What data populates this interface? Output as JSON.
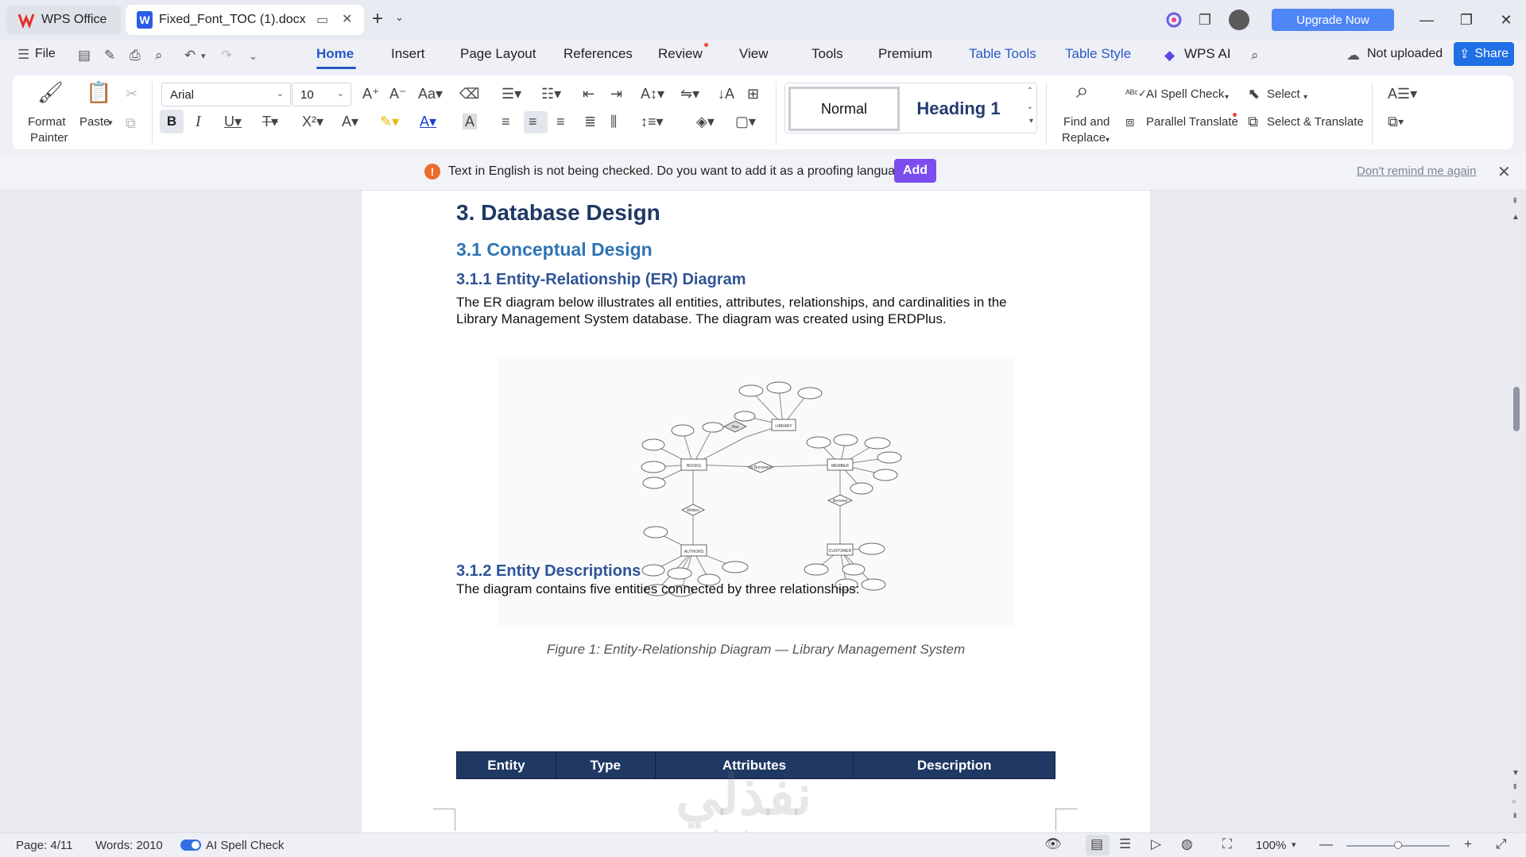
{
  "titlebar": {
    "app_tab": "WPS Office",
    "doc_tab": "Fixed_Font_TOC (1).docx",
    "upgrade": "Upgrade Now"
  },
  "menu": {
    "file": "File",
    "tabs": [
      "Home",
      "Insert",
      "Page Layout",
      "References",
      "Review",
      "View",
      "Tools",
      "Premium",
      "Table Tools",
      "Table Style",
      "WPS AI"
    ],
    "not_uploaded": "Not uploaded",
    "share": "Share"
  },
  "ribbon": {
    "format_painter": [
      "Format",
      "Painter"
    ],
    "paste": "Paste",
    "font": "Arial",
    "size": "10",
    "styles": {
      "normal": "Normal",
      "heading1": "Heading 1"
    },
    "find_replace": [
      "Find and",
      "Replace"
    ],
    "ai_spell": "AI Spell Check",
    "parallel_translate": "Parallel Translate",
    "select": "Select",
    "select_translate": "Select & Translate"
  },
  "notification": {
    "text": "Text in English is not being checked. Do you want to add it as a proofing language?",
    "add": "Add",
    "dont_remind": "Don't remind me again"
  },
  "document": {
    "h_main": "3. Database Design",
    "h_sub": "3.1 Conceptual Design",
    "h_sub2": "3.1.1 Entity-Relationship (ER) Diagram",
    "para1_line1": "The ER diagram below illustrates all entities, attributes, relationships, and cardinalities in the",
    "para1_line2": "Library Management System database. The diagram was created using ERDPlus.",
    "caption": "Figure 1: Entity-Relationship Diagram — Library Management System",
    "h_sub3": "3.1.2 Entity Descriptions",
    "para2": "The diagram contains five entities connected by three relationships:",
    "table_headers": [
      "Entity",
      "Type",
      "Attributes",
      "Description"
    ]
  },
  "diagram": {
    "entities": [
      "LIBRARY",
      "BOOKS",
      "MEMBER",
      "AUTHORS",
      "CUSTOMER"
    ],
    "relationships": [
      "Has",
      "Is Borrowed",
      "Written",
      "Borrows"
    ]
  },
  "watermark": {
    "main": "نفذلي",
    "sub": "nafezly.com"
  },
  "status": {
    "page": "Page: 4/11",
    "words": "Words: 2010",
    "spell": "AI Spell Check",
    "zoom": "100%"
  }
}
